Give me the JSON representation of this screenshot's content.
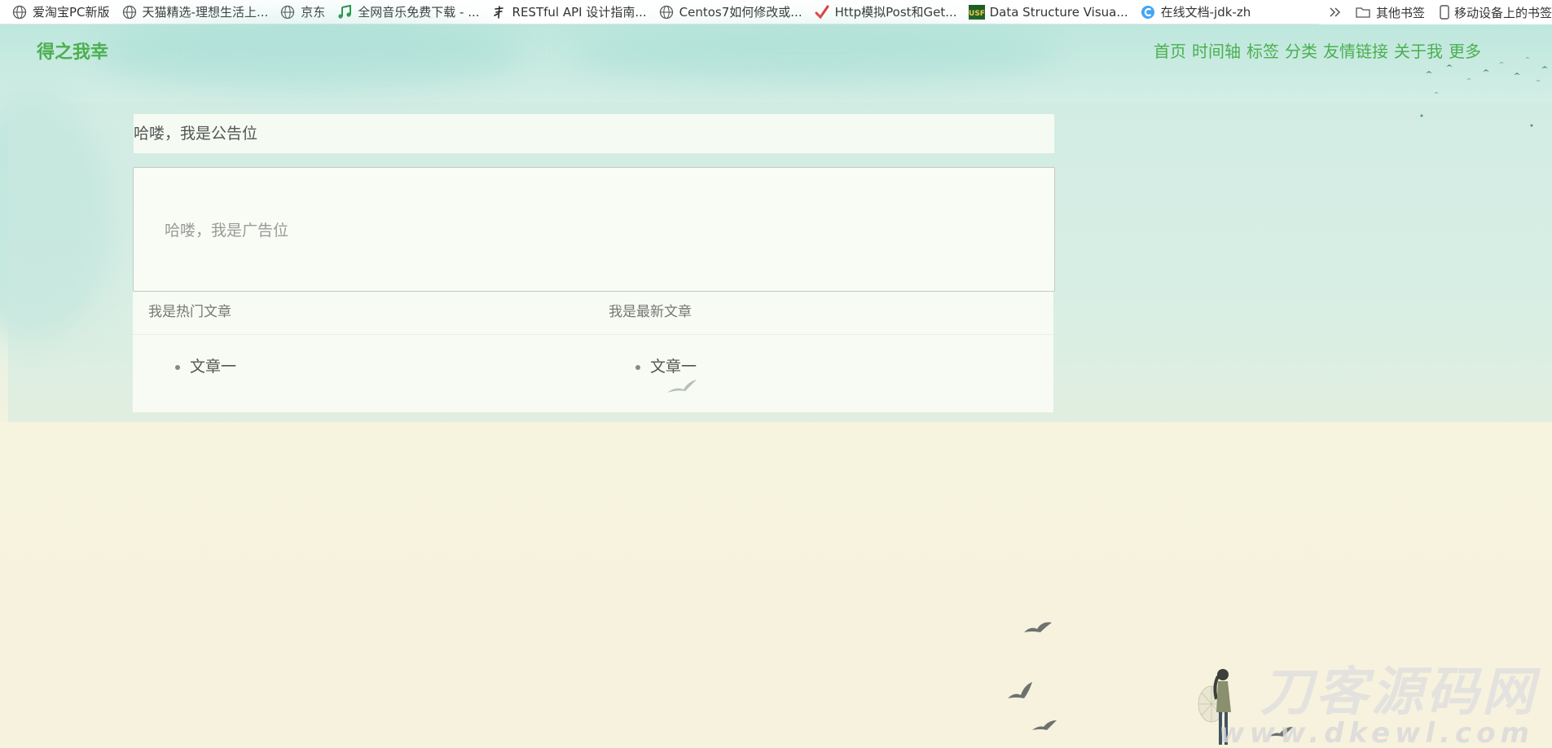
{
  "bookmarks": {
    "items": [
      {
        "label": "爱淘宝PC新版",
        "icon": "globe-icon"
      },
      {
        "label": "天猫精选-理想生活上...",
        "icon": "globe-icon"
      },
      {
        "label": "京东",
        "icon": "globe-icon"
      },
      {
        "label": "全网音乐免费下载 - ...",
        "icon": "music-note-icon"
      },
      {
        "label": "RESTful API 设计指南...",
        "icon": "brush-icon"
      },
      {
        "label": "Centos7如何修改或...",
        "icon": "globe-icon"
      },
      {
        "label": "Http模拟Post和Get...",
        "icon": "checkmark-icon"
      },
      {
        "label": "Data Structure Visua...",
        "icon": "usf-icon"
      },
      {
        "label": "在线文档-jdk-zh",
        "icon": "c-logo-icon"
      }
    ],
    "overflow_icon": "double-chevron-icon",
    "other_bookmarks": "其他书签",
    "mobile_bookmarks": "移动设备上的书签"
  },
  "header": {
    "site_title": "得之我幸",
    "nav": [
      "首页",
      "时间轴",
      "标签",
      "分类",
      "友情链接",
      "关于我",
      "更多"
    ]
  },
  "main": {
    "notice": "哈喽，我是公告位",
    "ad": "哈喽，我是广告位",
    "hot_articles": {
      "title": "我是热门文章",
      "items": [
        "文章一"
      ]
    },
    "latest_articles": {
      "title": "我是最新文章",
      "items": [
        "文章一"
      ]
    }
  },
  "watermark": {
    "cn": "刀客源码网",
    "url": "www.dkewl.com"
  },
  "colors": {
    "accent": "#4caf50",
    "text": "#555555"
  }
}
